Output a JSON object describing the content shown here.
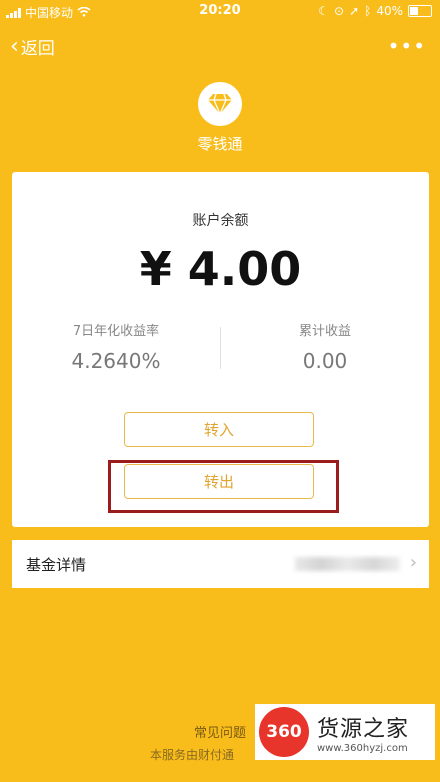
{
  "status": {
    "carrier": "中国移动",
    "time": "20:20",
    "battery": "40%"
  },
  "nav": {
    "back_label": "返回",
    "more_label": "•••"
  },
  "product": {
    "name": "零钱通"
  },
  "account": {
    "balance_label": "账户余额",
    "balance": "¥ 4.00",
    "rate_label": "7日年化收益率",
    "rate_value": "4.2640%",
    "earnings_label": "累计收益",
    "earnings_value": "0.00"
  },
  "actions": {
    "transfer_in": "转入",
    "transfer_out": "转出"
  },
  "fund": {
    "label": "基金详情"
  },
  "footer": {
    "faq": "常见问题",
    "note": "本服务由财付通"
  },
  "watermark": {
    "logo": "360",
    "title": "货源之家",
    "url": "www.360hyzj.com"
  },
  "colors": {
    "background": "#F9BD1B",
    "button_border": "#E8B94A",
    "highlight": "#9B1C1C"
  }
}
